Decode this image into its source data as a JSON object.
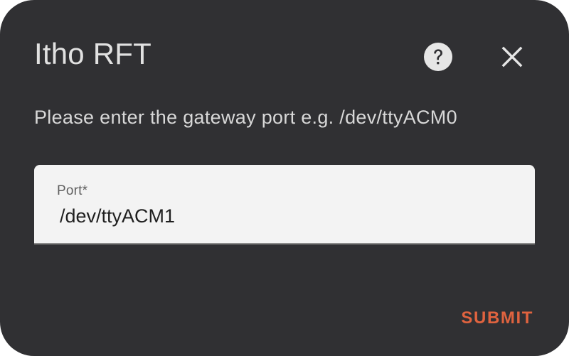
{
  "dialog": {
    "title": "Itho RFT",
    "help_icon": "help-circle-icon",
    "close_icon": "close-icon",
    "description": "Please enter the gateway port e.g. /dev/ttyACM0"
  },
  "port_field": {
    "label": "Port*",
    "value": "/dev/ttyACM1"
  },
  "actions": {
    "submit_label": "SUBMIT"
  },
  "colors": {
    "dialog_background": "#303033",
    "field_background": "#f3f3f3",
    "accent": "#e0633f"
  }
}
